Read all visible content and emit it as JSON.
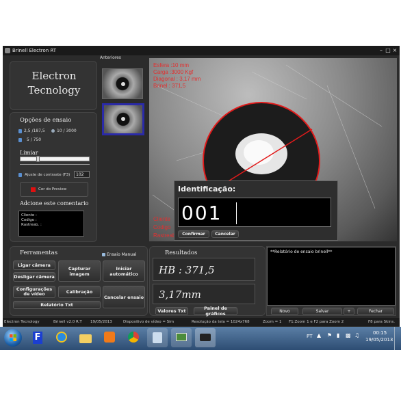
{
  "window": {
    "title": "Brinell Electron RT"
  },
  "logo": {
    "line1": "Electron",
    "line2": "Tecnology"
  },
  "opcoes": {
    "title": "Opções de ensaio",
    "opt1": "2,5 /187,5",
    "opt2": "10 / 3000",
    "opt3": "5  / 750",
    "limiar": "Limiar",
    "contrast_label": "Ajuste de contraste (F3)",
    "contrast_value": "102",
    "preview_label": "Cor do Preview",
    "preview_color": "#e01010",
    "comment_title": "Adcione este comentario",
    "comment_lines": [
      "Cliente    :",
      "Codigo     :",
      "Rastreab. :"
    ]
  },
  "anteriores": {
    "label": "Anteriores"
  },
  "overlay": {
    "line1": "Esfera :10 mm",
    "line2": "Carga :3000 Kgf",
    "line3": "Diagonal : 3,17 mm",
    "line4": "Brinel : 371,5",
    "bottom1": "Cliente",
    "bottom2": "Codigo",
    "bottom3": "Rastreab"
  },
  "dialog": {
    "title": "Identificação:",
    "value": "001",
    "confirm": "Confirmar",
    "cancel": "Cancelar"
  },
  "ferramentas": {
    "title": "Ferramentas",
    "ensaio_manual": "Ensaio Manual",
    "ligar": "Ligar câmera",
    "desligar": "Desligar câmera",
    "capturar": "Capturar imagem",
    "auto": "Iniciar automático",
    "config": "Configurações de vídeo",
    "calibracao": "Calibração",
    "cancelar": "Cancelar ensaio",
    "relatorio": "Relatório Txt"
  },
  "resultados": {
    "title": "Resultados",
    "hb": "HB : 371,5",
    "diam": "3,17mm",
    "valores": "Valores Txt",
    "painel": "Painel de gráficos"
  },
  "report": {
    "title": "**Relatório de ensaio brinell**",
    "novo": "Novo",
    "salvar": "Salvar",
    "plus": "+",
    "fechar": "Fechar"
  },
  "status": {
    "s1": "Electron Tecnology",
    "s2": "Brinell v2.0 R.T",
    "s3": "19/05/2013",
    "s4": "Dispositivo de vídeo = Sim",
    "s5": "Resolução da tela = 1024x768",
    "s6": "Zoom = 1",
    "s7": "F1:Zoom 1 e F2 para Zoom 2",
    "s8": "F8 para Skins."
  },
  "tray": {
    "lang": "PT",
    "time": "00:15",
    "date": "19/05/2013"
  }
}
